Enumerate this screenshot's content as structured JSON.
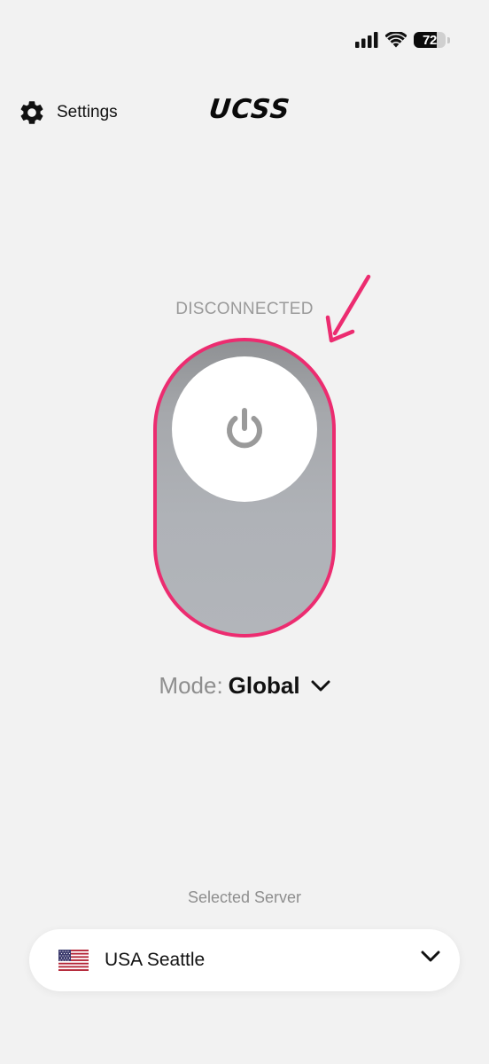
{
  "status_bar": {
    "battery_level": "72",
    "icons": [
      "cellular-signal-icon",
      "wifi-icon",
      "battery-icon"
    ]
  },
  "header": {
    "settings_label": "Settings",
    "app_logo_text": "UCSS",
    "settings_icon": "gear-icon"
  },
  "connection": {
    "status_text": "DISCONNECTED",
    "state": "off",
    "toggle_icon": "power-icon"
  },
  "mode": {
    "label": "Mode:",
    "value": "Global",
    "icon": "chevron-down-icon"
  },
  "server": {
    "section_label": "Selected Server",
    "name": "USA Seattle",
    "flag_icon": "us-flag-icon",
    "chevron_icon": "chevron-down-icon"
  },
  "colors": {
    "background": "#f2f2f2",
    "toggle_outline": "#ec2c70",
    "toggle_track": "#aeb1b6",
    "annotation_arrow": "#ec2c70",
    "status_text": "#9a9a9a"
  }
}
